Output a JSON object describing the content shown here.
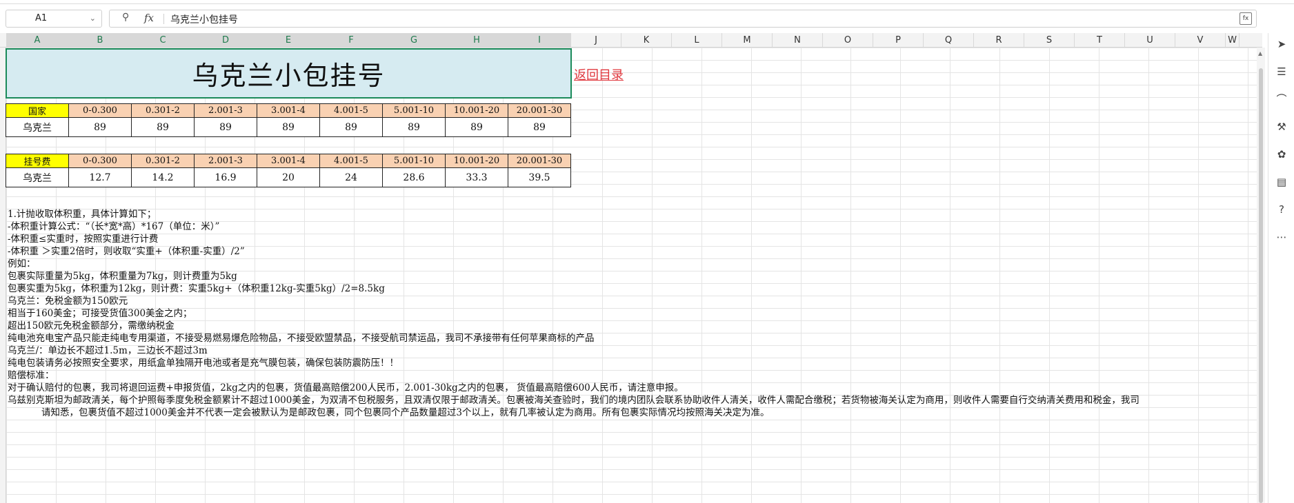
{
  "formula_bar": {
    "cell_ref": "A1",
    "formula": "乌克兰小包挂号"
  },
  "columns": [
    "A",
    "B",
    "C",
    "D",
    "E",
    "F",
    "G",
    "H",
    "I",
    "J",
    "K",
    "L",
    "M",
    "N",
    "O",
    "P",
    "Q",
    "R",
    "S",
    "T",
    "U",
    "V",
    "W"
  ],
  "sheet": {
    "title": "乌克兰小包挂号",
    "return_link": "返回目录",
    "weight_table": {
      "headers": [
        "国家",
        "0-0.300",
        "0.301-2",
        "2.001-3",
        "3.001-4",
        "4.001-5",
        "5.001-10",
        "10.001-20",
        "20.001-30"
      ],
      "row": [
        "乌克兰",
        "89",
        "89",
        "89",
        "89",
        "89",
        "89",
        "89",
        "89"
      ]
    },
    "fee_table": {
      "headers": [
        "挂号费",
        "0-0.300",
        "0.301-2",
        "2.001-3",
        "3.001-4",
        "4.001-5",
        "5.001-10",
        "10.001-20",
        "20.001-30"
      ],
      "row": [
        "乌克兰",
        "12.7",
        "14.2",
        "16.9",
        "20",
        "24",
        "28.6",
        "33.3",
        "39.5"
      ]
    },
    "notes": [
      "1.计抛收取体积重，具体计算如下；",
      "-体积重计算公式：“（长*宽*高）*167（单位：米）”",
      "-体积重≤实重时，按照实重进行计费",
      "-体积重 ＞实重2倍时，则收取“实重+（体积重-实重）/2”",
      "例如：",
      "包裹实际重量为5kg，体积重量为7kg，则计费重为5kg",
      "包裹实重为5kg，体积重为12kg，则计费：实重5kg+（体积重12kg-实重5kg）/2=8.5kg",
      "乌克兰：免税金额为150欧元",
      "相当于160美金；可接受货值300美金之内；",
      "超出150欧元免税金额部分，需缴纳税金",
      "纯电池充电宝产品只能走纯电专用渠道，不接受易燃易爆危险物品，不接受欧盟禁品，不接受航司禁运品，我司不承接带有任何苹果商标的产品",
      "乌克兰/：单边长不超过1.5m，三边长不超过3m",
      "纯电包装请务必按照安全要求，用纸盒单独隔开电池或者是充气膜包装，确保包装防震防压！！",
      "赔偿标准：",
      "对于确认赔付的包裹，我司将退回运费+申报货值，2kg之内的包裹，货值最高赔偿200人民币，2.001-30kg之内的包裹， 货值最高赔偿600人民币，请注意申报。",
      "乌兹别克斯坦为邮政清关，每个护照每季度免税金额累计不超过1000美金，为双清不包税服务，且双清仅限于邮政清关。包裹被海关查验时，我们的境内团队会联系协助收件人清关，收件人需配合缴税；若货物被海关认定为商用，则收件人需要自行交纳清关费用和税金，我司",
      "请知悉，包裹货值不超过1000美金并不代表一定会被默认为是邮政包裹，同个包裹同个产品数量超过3个以上，就有几率被认定为商用。所有包裹实际情况均按照海关决定为准。"
    ]
  },
  "icons": {
    "zoom": "zoom-icon",
    "fx": "fx-icon",
    "expand": "expand-formula-icon",
    "tools": [
      "cursor-icon",
      "sliders-icon",
      "crop-icon",
      "tools-icon",
      "style-icon",
      "book-icon",
      "help-icon",
      "more-icon"
    ]
  },
  "colors": {
    "title_bg": "#d6ebf1",
    "title_border": "#1b8a5a",
    "header_first_bg": "#ffff00",
    "header_bg": "#f9d1b2",
    "link": "#e0383e"
  }
}
